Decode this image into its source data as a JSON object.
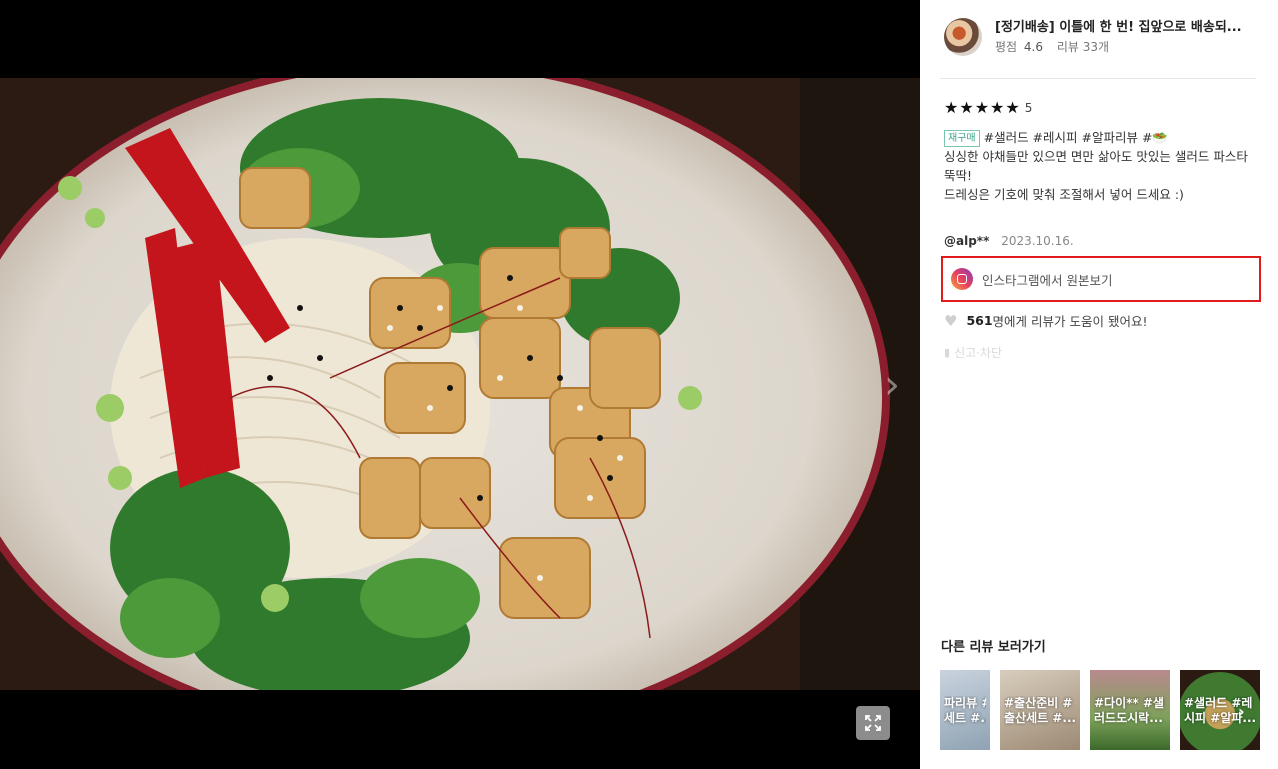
{
  "product": {
    "title": "[정기배송] 이틀에 한 번! 집앞으로 배송되...",
    "rating_label": "평점",
    "rating": "4.6",
    "reviews": "리뷰 33개"
  },
  "review": {
    "stars": 5,
    "score": "5",
    "rebuy_badge": "재구매",
    "tags": "#샐러드 #레시피 #알파리뷰 #🥗",
    "body_line1": "싱싱한 야채들만 있으면 면만 삶아도 맛있는 샐러드 파스타 뚝딱!",
    "body_line2": "드레싱은 기호에 맞춰 조절해서 넣어 드세요 :)",
    "author": "@alp**",
    "date": "2023.10.16.",
    "instagram_label": "인스타그램에서 원본보기",
    "helpful_count": "561",
    "helpful_text": "명에게 리뷰가 도움이 됐어요!",
    "report_label": "신고·차단"
  },
  "other_reviews": {
    "title": "다른 리뷰 보러가기",
    "items": [
      {
        "caption": "파리뷰 #\n세트 #..."
      },
      {
        "caption": "#출산준비 #\n출산세트 #..."
      },
      {
        "caption": "#다이** #샐\n러드도시락..."
      },
      {
        "caption": "#샐러드 #레\n시피 #알파..."
      }
    ]
  },
  "icons": {
    "viewer_next": "chevron-right-icon",
    "fullscreen": "expand-icon",
    "instagram": "instagram-icon",
    "heart": "heart-icon",
    "report": "user-block-icon",
    "thumbs_next": "chevron-right-icon"
  },
  "colors": {
    "highlight_border": "#e01b1b",
    "rebuy_badge": "#3aa58a"
  }
}
